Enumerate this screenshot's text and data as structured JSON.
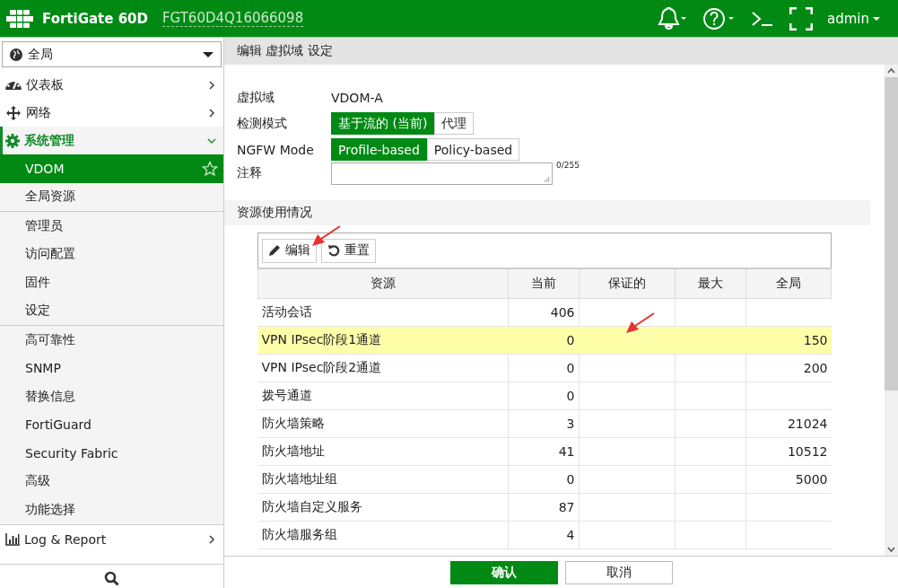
{
  "header": {
    "product": "FortiGate 60D",
    "serial": "FGT60D4Q16066098",
    "user": "admin"
  },
  "sidebar": {
    "scope": "全局",
    "items": [
      {
        "label": "仪表板",
        "expanded": false
      },
      {
        "label": "网络",
        "expanded": false
      },
      {
        "label": "系统管理",
        "expanded": true,
        "groups": [
          {
            "items": [
              {
                "label": "VDOM",
                "selected": true
              },
              {
                "label": "全局资源",
                "selected": false
              }
            ]
          },
          {
            "items": [
              {
                "label": "管理员",
                "selected": false
              },
              {
                "label": "访问配置",
                "selected": false
              },
              {
                "label": "固件",
                "selected": false
              },
              {
                "label": "设定",
                "selected": false
              }
            ]
          },
          {
            "items": [
              {
                "label": "高可靠性",
                "selected": false
              },
              {
                "label": "SNMP",
                "selected": false
              },
              {
                "label": "替换信息",
                "selected": false
              },
              {
                "label": "FortiGuard",
                "selected": false
              },
              {
                "label": "Security Fabric",
                "selected": false
              },
              {
                "label": "高级",
                "selected": false
              },
              {
                "label": "功能选择",
                "selected": false
              }
            ]
          }
        ]
      },
      {
        "label": "Log & Report",
        "expanded": false
      }
    ]
  },
  "page_title": "编辑 虚拟域 设定",
  "form": {
    "vdom_label": "虚拟域",
    "vdom_value": "VDOM-A",
    "inspection_label": "检测模式",
    "inspection_options": [
      {
        "label": "基于流的 (当前)",
        "selected": true
      },
      {
        "label": "代理",
        "selected": false
      }
    ],
    "ngfw_label": "NGFW Mode",
    "ngfw_options": [
      {
        "label": "Profile-based",
        "selected": true
      },
      {
        "label": "Policy-based",
        "selected": false
      }
    ],
    "comment_label": "注释",
    "comment_counter": "0/255"
  },
  "resources": {
    "title": "资源使用情况",
    "buttons": [
      "编辑",
      "重置"
    ],
    "columns": [
      "资源",
      "当前",
      "保证的",
      "最大",
      "全局"
    ],
    "rows": [
      {
        "cells": [
          "活动会话",
          "406",
          "",
          "",
          ""
        ],
        "selected": false
      },
      {
        "cells": [
          "VPN IPsec阶段1通道",
          "0",
          "",
          "",
          "150"
        ],
        "selected": true
      },
      {
        "cells": [
          "VPN IPsec阶段2通道",
          "0",
          "",
          "",
          "200"
        ],
        "selected": false
      },
      {
        "cells": [
          "拨号通道",
          "0",
          "",
          "",
          ""
        ],
        "selected": false
      },
      {
        "cells": [
          "防火墙策略",
          "3",
          "",
          "",
          "21024"
        ],
        "selected": false
      },
      {
        "cells": [
          "防火墙地址",
          "41",
          "",
          "",
          "10512"
        ],
        "selected": false
      },
      {
        "cells": [
          "防火墙地址组",
          "0",
          "",
          "",
          "5000"
        ],
        "selected": false
      },
      {
        "cells": [
          "防火墙自定义服务",
          "87",
          "",
          "",
          ""
        ],
        "selected": false
      },
      {
        "cells": [
          "防火墙服务组",
          "4",
          "",
          "",
          ""
        ],
        "selected": false
      }
    ]
  },
  "footer": {
    "buttons": [
      "确认",
      "取消"
    ]
  }
}
